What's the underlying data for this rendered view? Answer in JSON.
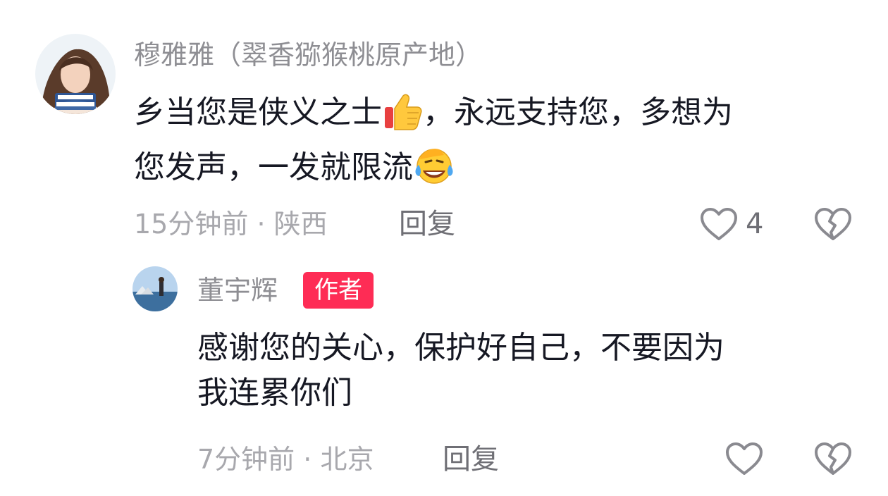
{
  "comment": {
    "username": "穆雅雅（翠香猕猴桃原产地）",
    "text_part1": "乡当您是侠义之士",
    "text_part2": "，永远支持您，多想为",
    "text_line2": "您发声，一发就限流",
    "emoji_1": "thumbs-up-icon",
    "emoji_2": "laughing-crying-icon",
    "time": "15分钟前",
    "separator": "·",
    "location": "陕西",
    "reply_label": "回复",
    "like_count": "4"
  },
  "reply": {
    "username": "董宇辉",
    "badge": "作者",
    "badge_color": "#fe2c55",
    "text_line1": "感谢您的关心，保护好自己，不要因为",
    "text_line2": "我连累你们",
    "time": "7分钟前",
    "separator": "·",
    "location": "北京",
    "reply_label": "回复"
  }
}
